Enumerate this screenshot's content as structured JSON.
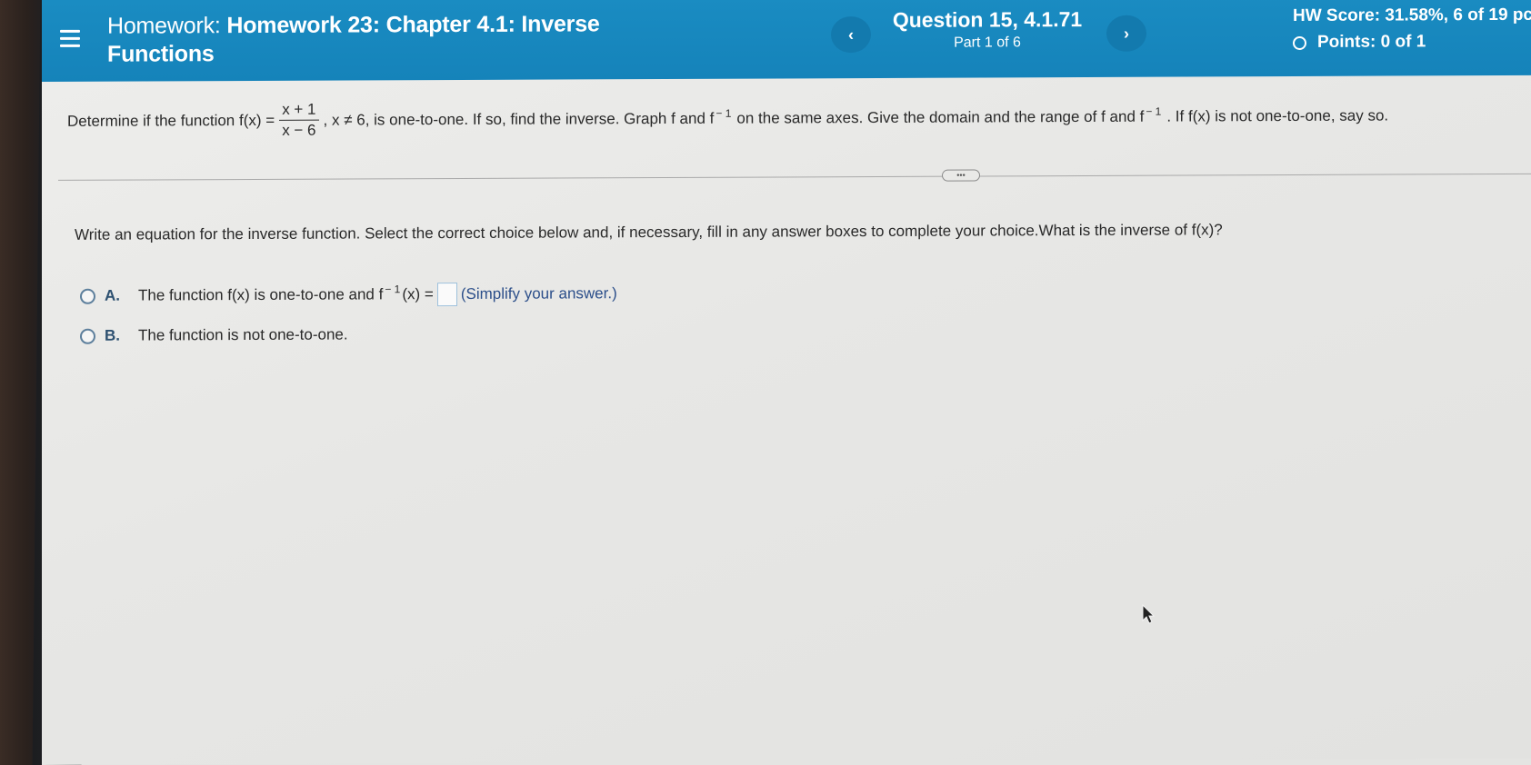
{
  "header": {
    "menu_icon": "menu-icon",
    "title_prefix": "Homework:",
    "title_main": "Homework 23: Chapter 4.1: Inverse",
    "title_line2": "Functions",
    "prev_label": "‹",
    "next_label": "›",
    "question_label": "Question 15, 4.1.71",
    "part_label": "Part 1 of 6",
    "hw_score": "HW Score: 31.58%, 6 of 19 pc",
    "points": "Points: 0 of 1"
  },
  "prompt": {
    "text_1": "Determine if the function f(x) =",
    "numerator": "x + 1",
    "denominator": "x − 6",
    "text_2": ", x ≠ 6, is one-to-one.  If so, find the inverse. Graph f and f",
    "inv_1": "− 1",
    "text_3": "on the same axes. Give the domain and the range of f and f",
    "inv_2": "− 1",
    "text_4": ".  If f(x) is not one-to-one, say so."
  },
  "expand_label": "•••",
  "instruction": "Write an equation for the inverse function. Select the correct choice below and, if necessary, fill in any answer boxes to complete your choice.What is the inverse of f(x)?",
  "choices": {
    "a": {
      "letter": "A.",
      "text_before": "The function f(x) is one-to-one and f",
      "inv": "− 1",
      "text_after": "(x) =",
      "hint": "(Simplify your answer.)",
      "answer_value": ""
    },
    "b": {
      "letter": "B.",
      "text": "The function is not one-to-one."
    }
  },
  "colors": {
    "header_bg": "#1a8cc2",
    "accent_text": "#2c4f8a"
  }
}
